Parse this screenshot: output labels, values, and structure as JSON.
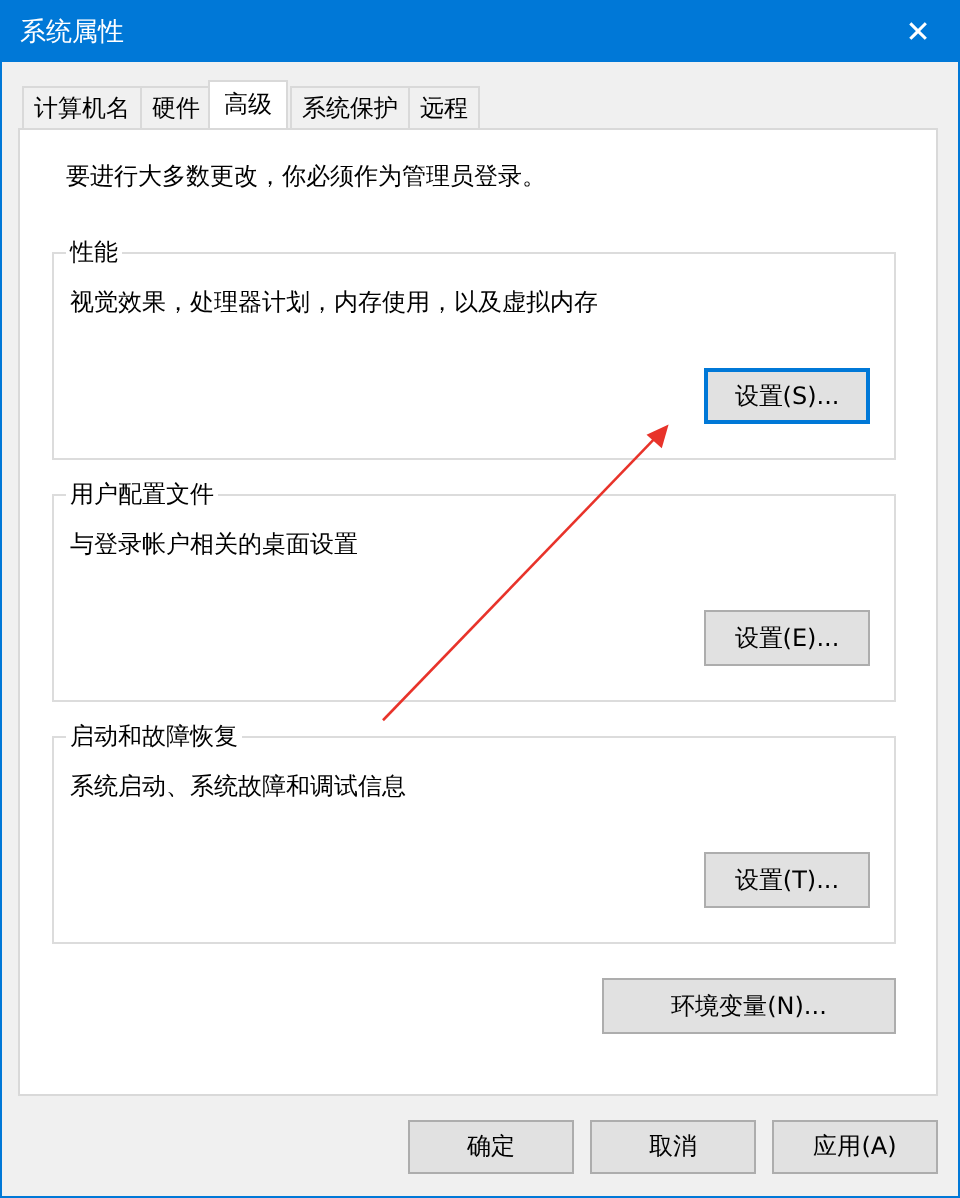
{
  "window": {
    "title": "系统属性",
    "close": "✕"
  },
  "tabs": [
    {
      "label": "计算机名",
      "selected": false
    },
    {
      "label": "硬件",
      "selected": false
    },
    {
      "label": "高级",
      "selected": true
    },
    {
      "label": "系统保护",
      "selected": false
    },
    {
      "label": "远程",
      "selected": false
    }
  ],
  "notice": "要进行大多数更改，你必须作为管理员登录。",
  "groups": [
    {
      "title": "性能",
      "description": "视觉效果，处理器计划，内存使用，以及虚拟内存",
      "button": "设置(S)...",
      "focused": true
    },
    {
      "title": "用户配置文件",
      "description": "与登录帐户相关的桌面设置",
      "button": "设置(E)...",
      "focused": false
    },
    {
      "title": "启动和故障恢复",
      "description": "系统启动、系统故障和调试信息",
      "button": "设置(T)...",
      "focused": false
    }
  ],
  "env_button": "环境变量(N)...",
  "annotation": {
    "kind": "arrow"
  },
  "buttons": [
    "确定",
    "取消",
    "应用(A)"
  ]
}
